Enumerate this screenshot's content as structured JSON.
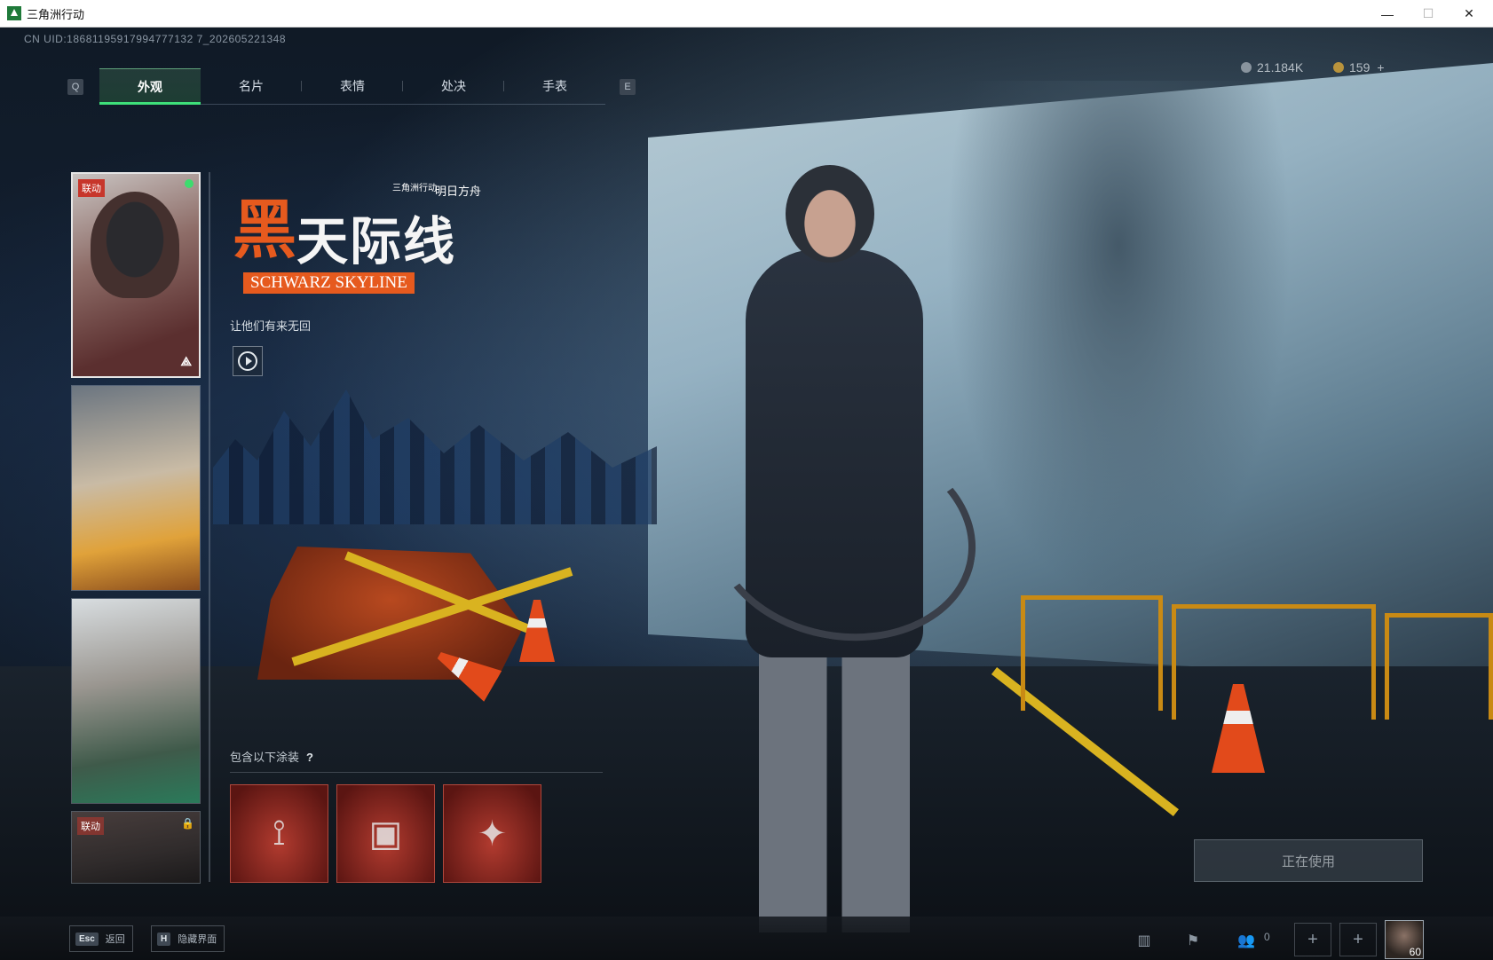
{
  "window": {
    "title": "三角洲行动",
    "minimize": "—",
    "maximize": "☐",
    "close": "✕"
  },
  "uid": "CN UID:18681195917994777132 7_202605221348",
  "tabs": {
    "left_key": "Q",
    "right_key": "E",
    "items": [
      {
        "label": "外观",
        "active": true
      },
      {
        "label": "名片",
        "active": false
      },
      {
        "label": "表情",
        "active": false
      },
      {
        "label": "处决",
        "active": false
      },
      {
        "label": "手表",
        "active": false
      }
    ]
  },
  "currency": {
    "primary": "21.184K",
    "secondary": "159",
    "add": "+"
  },
  "cards": [
    {
      "tag": "联动",
      "selected": true,
      "brand": "⟁"
    },
    {
      "tag": "",
      "selected": false
    },
    {
      "tag": "",
      "selected": false
    },
    {
      "tag": "联动",
      "selected": false,
      "locked": true,
      "lock_icon": "🔒"
    }
  ],
  "skin": {
    "logo_prefix": "黑",
    "logo_title": "天际线",
    "logo_english": "SCHWARZ SKYLINE",
    "collab_brand_a": "三角洲行动",
    "collab_brand_b": "明日方舟",
    "slogan": "让他们有来无回",
    "contains_label": "包含以下涂装",
    "help_icon": "?",
    "items": [
      {
        "icon": "bow-icon",
        "glyph": "⟟"
      },
      {
        "icon": "case-icon",
        "glyph": "▣"
      },
      {
        "icon": "figure-icon",
        "glyph": "✦"
      }
    ]
  },
  "status_button": "正在使用",
  "bottom": {
    "esc_key": "Esc",
    "esc_label": "返回",
    "h_key": "H",
    "h_label": "隐藏界面",
    "friends_count": "0",
    "plus": "+",
    "level": "60"
  },
  "colors": {
    "accent_green": "#3ee07a",
    "brand_orange": "#e65a1e",
    "tag_red": "#c7362b"
  }
}
